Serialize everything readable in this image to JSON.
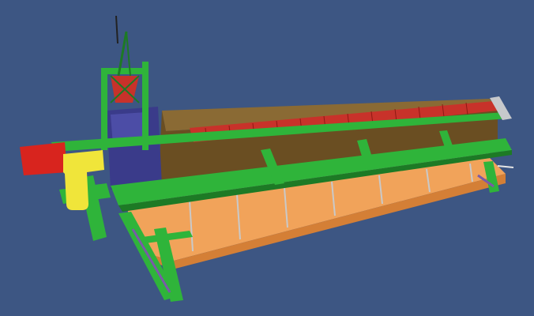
{
  "scene": {
    "subject": "filter-press",
    "colors": {
      "background": "#3d5683",
      "frame": "#2fb43a",
      "frame_dark": "#1d7a25",
      "plates": "#8a6a34",
      "plates_dark": "#6a4e22",
      "red_handles": "#c8322a",
      "tray": "#f1a35a",
      "tray_dark": "#d47f36",
      "yellow_pipe": "#f0e53a",
      "red_pipe": "#d8241e",
      "hydraulic_block": "#3a3b8a",
      "grey_steel": "#a7aab0",
      "purple_legs": "#7a5aa8"
    }
  }
}
